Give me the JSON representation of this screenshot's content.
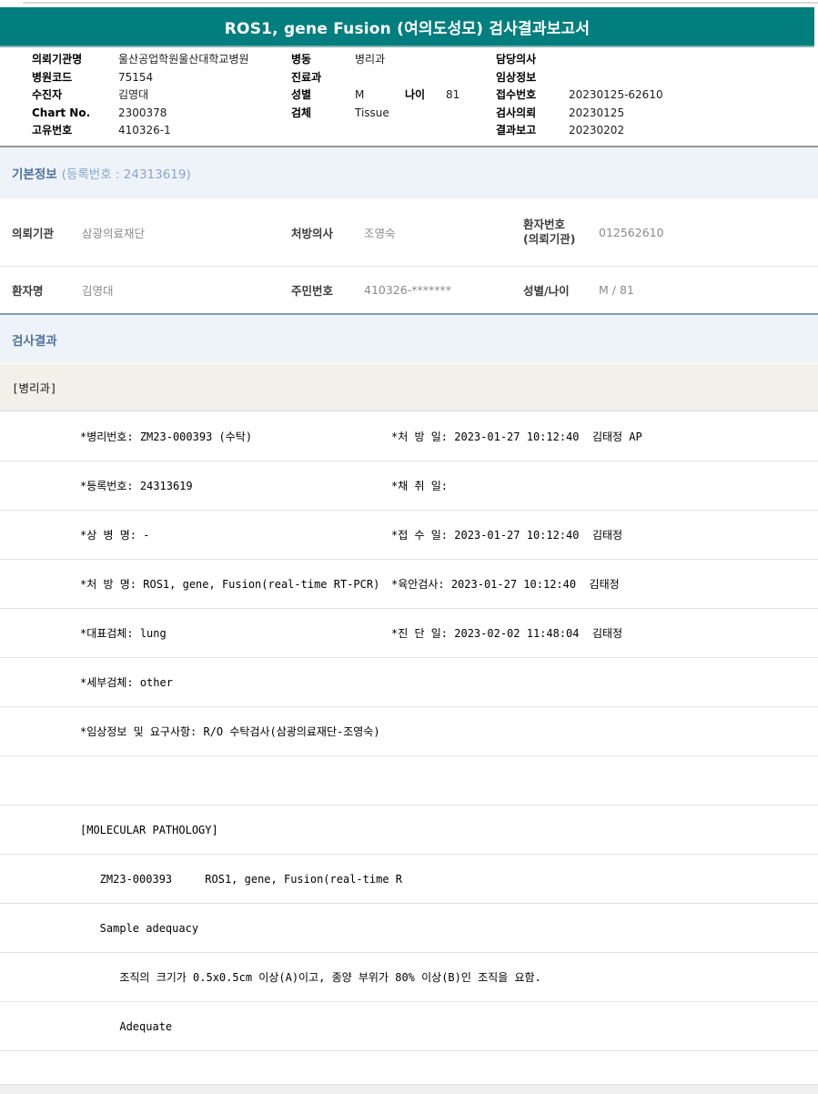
{
  "title": "ROS1, gene Fusion (여의도성모) 검사결과보고서",
  "header": {
    "left": [
      {
        "label": "의뢰기관명",
        "value": "울산공업학원울산대학교병원"
      },
      {
        "label": "병원코드",
        "value": "75154"
      },
      {
        "label": "수진자",
        "value": "김영대"
      },
      {
        "label": "Chart No.",
        "value": "2300378"
      },
      {
        "label": "고유번호",
        "value": "410326-1"
      }
    ],
    "middle": [
      {
        "label": "병동",
        "value": "병리과"
      },
      {
        "label": "진료과",
        "value": ""
      },
      {
        "label": "성별",
        "value": "M"
      },
      {
        "label": "검체",
        "value": "Tissue"
      }
    ],
    "age": {
      "label": "나이",
      "value": "81"
    },
    "right": [
      {
        "label": "담당의사",
        "value": ""
      },
      {
        "label": "임상정보",
        "value": ""
      },
      {
        "label": "접수번호",
        "value": "20230125-62610"
      },
      {
        "label": "검사의뢰",
        "value": "20230125"
      },
      {
        "label": "결과보고",
        "value": "20230202"
      }
    ]
  },
  "basic_info": {
    "title": "기본정보",
    "subtitle": "(등록번호 : 24313619)",
    "row1": [
      {
        "label": "의뢰기관",
        "value": "삼광의료재단"
      },
      {
        "label": "처방의사",
        "value": "조영숙"
      },
      {
        "label": "환자번호",
        "label2": "(의뢰기관)",
        "value": "012562610"
      }
    ],
    "row2": [
      {
        "label": "환자명",
        "value": "김영대"
      },
      {
        "label": "주민번호",
        "value": "410326-*******"
      },
      {
        "label": "성별/나이",
        "value": "M / 81"
      }
    ]
  },
  "results": {
    "title": "검사결과",
    "category": "[병리과]",
    "rows": [
      {
        "left": "*병리번호: ZM23-000393 (수탁)",
        "right": "*처 방 일: 2023-01-27 10:12:40  김태정 AP"
      },
      {
        "left": "*등록번호: 24313619",
        "right": "*채 취 일:"
      },
      {
        "left": "*상 병 명: -",
        "right": "*접 수 일: 2023-01-27 10:12:40  김태정"
      },
      {
        "left": "*처 방 명: ROS1, gene, Fusion(real-time RT-PCR)",
        "right": "*육안검사: 2023-01-27 10:12:40  김태정"
      },
      {
        "left": "*대표검체: lung",
        "right": "*진 단 일: 2023-02-02 11:48:04  김태정"
      },
      {
        "left": "*세부검체: other",
        "right": ""
      },
      {
        "left": "*임상정보 및 요구사항: R/O 수탁검사(삼광의료재단-조영숙)",
        "right": ""
      },
      {
        "left": "",
        "right": ""
      },
      {
        "left": "[MOLECULAR PATHOLOGY]",
        "right": ""
      },
      {
        "left": "   ZM23-000393     ROS1, gene, Fusion(real-time R",
        "right": ""
      },
      {
        "left": "   Sample adequacy",
        "right": ""
      },
      {
        "left": "      조직의 크기가 0.5x0.5cm 이상(A)이고, 종양 부위가 80% 이상(B)인 조직을 요함.",
        "right": ""
      },
      {
        "left": "      Adequate",
        "right": ""
      },
      {
        "left": "",
        "right": ""
      }
    ]
  },
  "colors": {
    "accent_teal": "#037e7e",
    "section_bg": "#eef3f9",
    "section_text": "#50729e",
    "border_blue": "#7f9db9",
    "border_gray": "#9a958f",
    "category_bg": "#f3f0ea"
  }
}
